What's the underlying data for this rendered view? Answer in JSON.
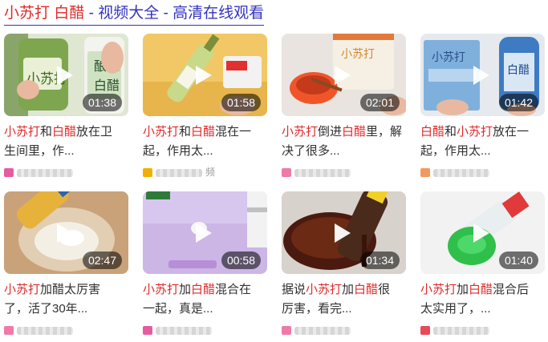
{
  "header": {
    "parts": [
      {
        "text": "小苏打",
        "highlight": true
      },
      {
        "text": " ",
        "highlight": false
      },
      {
        "text": "白醋",
        "highlight": true
      },
      {
        "text": " - 视频大全 - 高清在线观看",
        "highlight": false
      }
    ]
  },
  "colors": {
    "highlight": "#e02a2a",
    "link": "#3333c0",
    "text": "#303030"
  },
  "cards": [
    {
      "duration": "01:38",
      "title_line1": [
        {
          "t": "小苏打",
          "h": true
        },
        {
          "t": "和",
          "h": false
        },
        {
          "t": "白醋",
          "h": true
        },
        {
          "t": "放在卫",
          "h": false
        }
      ],
      "title_line2": [
        {
          "t": "生间里，作...",
          "h": false
        }
      ],
      "source_text": "",
      "icon_color": "#e65ca0",
      "play_icon": "play-icon"
    },
    {
      "duration": "01:58",
      "title_line1": [
        {
          "t": "小苏打",
          "h": true
        },
        {
          "t": "和",
          "h": false
        },
        {
          "t": "白醋",
          "h": true
        },
        {
          "t": "混在一",
          "h": false
        }
      ],
      "title_line2": [
        {
          "t": "起，作用太...",
          "h": false
        }
      ],
      "source_text": "频",
      "icon_color": "#f0b000",
      "play_icon": "play-icon"
    },
    {
      "duration": "02:01",
      "title_line1": [
        {
          "t": "小苏打",
          "h": true
        },
        {
          "t": "倒进",
          "h": false
        },
        {
          "t": "白醋",
          "h": true
        },
        {
          "t": "里，解",
          "h": false
        }
      ],
      "title_line2": [
        {
          "t": "决了很多...",
          "h": false
        }
      ],
      "source_text": "",
      "icon_color": "#f07aa8",
      "play_icon": "play-icon"
    },
    {
      "duration": "01:42",
      "title_line1": [
        {
          "t": "白醋",
          "h": true
        },
        {
          "t": "和",
          "h": false
        },
        {
          "t": "小苏打",
          "h": true
        },
        {
          "t": "放在一",
          "h": false
        }
      ],
      "title_line2": [
        {
          "t": "起，作用太...",
          "h": false
        }
      ],
      "source_text": "",
      "icon_color": "#f09a60",
      "play_icon": "play-icon"
    },
    {
      "duration": "02:47",
      "title_line1": [
        {
          "t": "小苏打",
          "h": true
        },
        {
          "t": "加醋太厉害",
          "h": false
        }
      ],
      "title_line2": [
        {
          "t": "了，活了30年...",
          "h": false
        }
      ],
      "source_text": "",
      "icon_color": "#f07aa8",
      "play_icon": "play-icon"
    },
    {
      "duration": "00:58",
      "title_line1": [
        {
          "t": "小苏打",
          "h": true
        },
        {
          "t": "加",
          "h": false
        },
        {
          "t": "白醋",
          "h": true
        },
        {
          "t": "混合在",
          "h": false
        }
      ],
      "title_line2": [
        {
          "t": "一起，真是...",
          "h": false
        }
      ],
      "source_text": "",
      "icon_color": "#e65ca0",
      "play_icon": "play-icon"
    },
    {
      "duration": "01:34",
      "title_line1": [
        {
          "t": "据说",
          "h": false
        },
        {
          "t": "小苏打",
          "h": true
        },
        {
          "t": "加",
          "h": false
        },
        {
          "t": "白醋",
          "h": true
        },
        {
          "t": "很",
          "h": false
        }
      ],
      "title_line2": [
        {
          "t": "厉害，看完...",
          "h": false
        }
      ],
      "source_text": "",
      "icon_color": "#f07aa8",
      "play_icon": "play-icon"
    },
    {
      "duration": "01:40",
      "title_line1": [
        {
          "t": "小苏打",
          "h": true
        },
        {
          "t": "加",
          "h": false
        },
        {
          "t": "白醋",
          "h": true
        },
        {
          "t": "混合后",
          "h": false
        }
      ],
      "title_line2": [
        {
          "t": "太实用了，...",
          "h": false
        }
      ],
      "source_text": "",
      "icon_color": "#e84a5a",
      "play_icon": "play-icon"
    }
  ]
}
